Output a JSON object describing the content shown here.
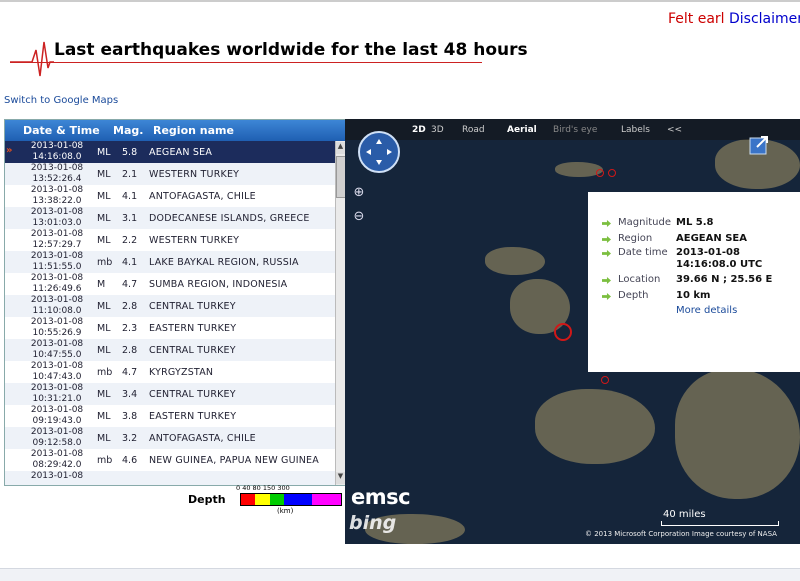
{
  "top_links": {
    "felt": "Felt earl",
    "disclaimer": "Disclaimer"
  },
  "header": {
    "title": "Last earthquakes worldwide for the last 48 hours"
  },
  "switch_link": "Switch to Google Maps",
  "table": {
    "columns": [
      "Date & Time",
      "Mag.",
      "Region name"
    ],
    "rows": [
      {
        "date": "2013-01-08",
        "time": "14:16:08.0",
        "mtype": "ML",
        "mag": "5.8",
        "region": "AEGEAN SEA",
        "selected": true
      },
      {
        "date": "2013-01-08",
        "time": "13:52:26.4",
        "mtype": "ML",
        "mag": "2.1",
        "region": "WESTERN TURKEY"
      },
      {
        "date": "2013-01-08",
        "time": "13:38:22.0",
        "mtype": "ML",
        "mag": "4.1",
        "region": "ANTOFAGASTA, CHILE"
      },
      {
        "date": "2013-01-08",
        "time": "13:01:03.0",
        "mtype": "ML",
        "mag": "3.1",
        "region": "DODECANESE ISLANDS, GREECE"
      },
      {
        "date": "2013-01-08",
        "time": "12:57:29.7",
        "mtype": "ML",
        "mag": "2.2",
        "region": "WESTERN TURKEY"
      },
      {
        "date": "2013-01-08",
        "time": "11:51:55.0",
        "mtype": "mb",
        "mag": "4.1",
        "region": "LAKE BAYKAL REGION, RUSSIA"
      },
      {
        "date": "2013-01-08",
        "time": "11:26:49.6",
        "mtype": "M",
        "mag": "4.7",
        "region": "SUMBA REGION, INDONESIA"
      },
      {
        "date": "2013-01-08",
        "time": "11:10:08.0",
        "mtype": "ML",
        "mag": "2.8",
        "region": "CENTRAL TURKEY"
      },
      {
        "date": "2013-01-08",
        "time": "10:55:26.9",
        "mtype": "ML",
        "mag": "2.3",
        "region": "EASTERN TURKEY"
      },
      {
        "date": "2013-01-08",
        "time": "10:47:55.0",
        "mtype": "ML",
        "mag": "2.8",
        "region": "CENTRAL TURKEY"
      },
      {
        "date": "2013-01-08",
        "time": "10:47:43.0",
        "mtype": "mb",
        "mag": "4.7",
        "region": "KYRGYZSTAN"
      },
      {
        "date": "2013-01-08",
        "time": "10:31:21.0",
        "mtype": "ML",
        "mag": "3.4",
        "region": "CENTRAL TURKEY"
      },
      {
        "date": "2013-01-08",
        "time": "09:19:43.0",
        "mtype": "ML",
        "mag": "3.8",
        "region": "EASTERN TURKEY"
      },
      {
        "date": "2013-01-08",
        "time": "09:12:58.0",
        "mtype": "ML",
        "mag": "3.2",
        "region": "ANTOFAGASTA, CHILE"
      },
      {
        "date": "2013-01-08",
        "time": "08:29:42.0",
        "mtype": "mb",
        "mag": "4.6",
        "region": "NEW GUINEA, PAPUA NEW GUINEA"
      },
      {
        "date": "2013-01-08",
        "time": "",
        "mtype": "",
        "mag": "",
        "region": ""
      }
    ]
  },
  "depth_legend": {
    "label": "Depth",
    "ticks": "0  40 80   150      300",
    "unit": "(km)",
    "colors": [
      "#ff0000",
      "#ffff00",
      "#00cc00",
      "#0000ff",
      "#ff00ff"
    ]
  },
  "map": {
    "toolbar": {
      "b2d": "2D",
      "b3d": "3D",
      "road": "Road",
      "aerial": "Aerial",
      "birdseye": "Bird's eye",
      "labels": "Labels",
      "collapse": "<<"
    },
    "popup": {
      "rows": [
        {
          "key": "Magnitude",
          "value": "ML 5.8"
        },
        {
          "key": "Region",
          "value": "AEGEAN SEA"
        },
        {
          "key": "Date time",
          "value": "2013-01-08 14:16:08.0 UTC"
        },
        {
          "key": "Location",
          "value": "39.66 N ; 25.56 E"
        },
        {
          "key": "Depth",
          "value": "10 km"
        }
      ],
      "more": "More details"
    },
    "emsc": "emsc",
    "bing": "bing",
    "scale": "40 miles",
    "copyright": "© 2013 Microsoft Corporation    Image courtesy of NASA"
  }
}
